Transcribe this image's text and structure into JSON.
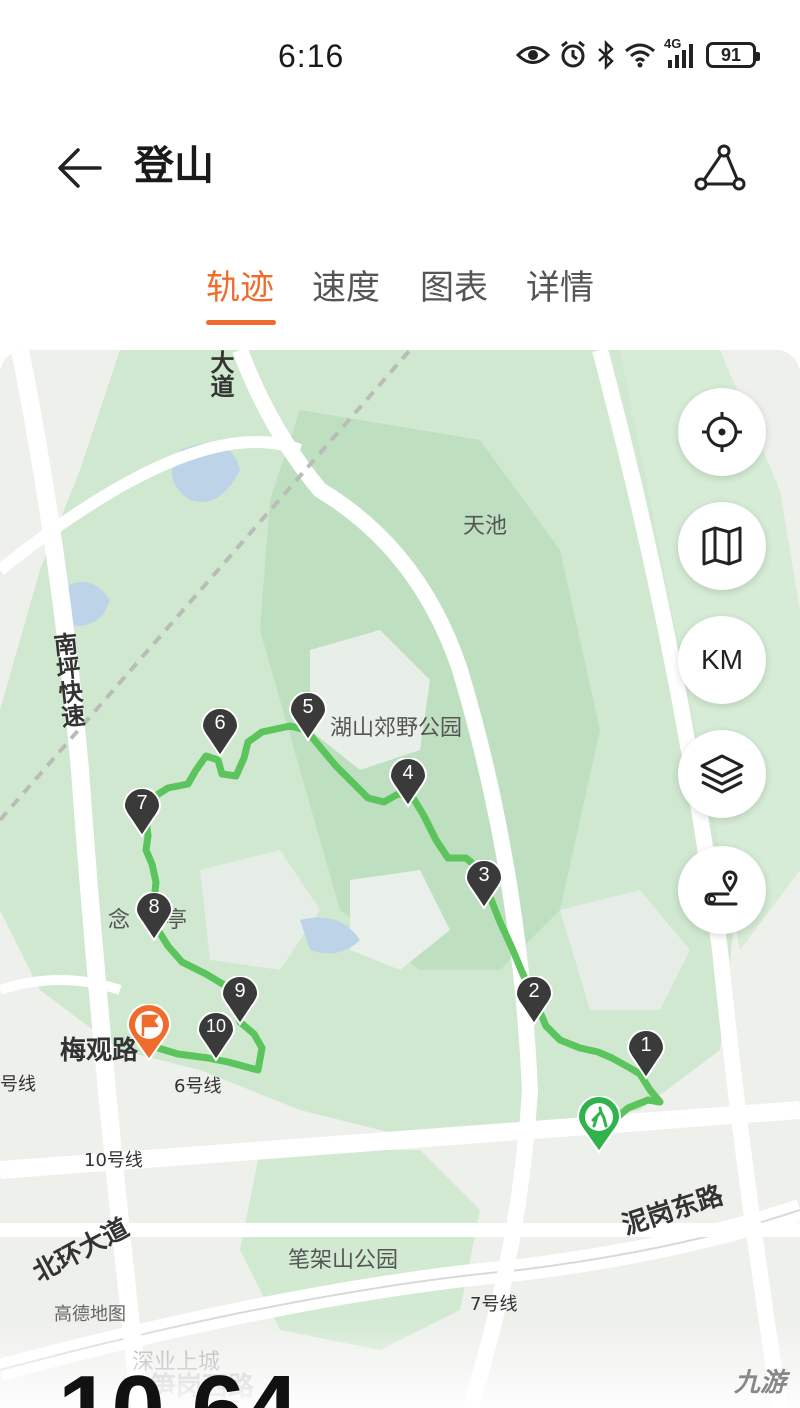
{
  "status_bar": {
    "time": "6:16",
    "network": "4G",
    "battery": "91",
    "icons": [
      "eye-icon",
      "alarm-icon",
      "bluetooth-icon",
      "wifi-icon",
      "signal-icon",
      "battery-icon"
    ]
  },
  "header": {
    "title": "登山",
    "back_icon": "arrow-left-icon",
    "route_icon": "route-share-icon"
  },
  "tabs": [
    {
      "label": "轨迹",
      "active": true
    },
    {
      "label": "速度",
      "active": false
    },
    {
      "label": "图表",
      "active": false
    },
    {
      "label": "详情",
      "active": false
    }
  ],
  "map": {
    "labels": {
      "tianchi": "天池",
      "park": "湖山郊野公园",
      "pavilion": "念",
      "pavilion2": "亭",
      "bijiashan": "笔架山公园",
      "line6": "6号线",
      "line10": "10号线",
      "line7": "7号线",
      "line_edge": "号线",
      "shenye": "深业上城",
      "amap": "高德地图"
    },
    "roads": {
      "dao": "大道",
      "nanping": "南坪快速",
      "meiguan": "梅观路",
      "nigang": "泥岗东路",
      "beihuan": "北环大道",
      "bizhu": "笋岗西路"
    },
    "controls": [
      {
        "name": "locate-icon"
      },
      {
        "name": "map-icon"
      },
      {
        "label": "KM"
      },
      {
        "name": "layers-icon"
      },
      {
        "name": "route-pin-icon"
      }
    ],
    "markers": [
      "1",
      "2",
      "3",
      "4",
      "5",
      "6",
      "7",
      "8",
      "9",
      "10"
    ],
    "colors": {
      "track": "#5cc45c",
      "marker": "#3a3a3a",
      "start": "#2fb34a",
      "end": "#ef6c2d",
      "accent": "#ef6c2d"
    }
  },
  "summary": {
    "distance_value": "10.64"
  },
  "watermark": "九游"
}
